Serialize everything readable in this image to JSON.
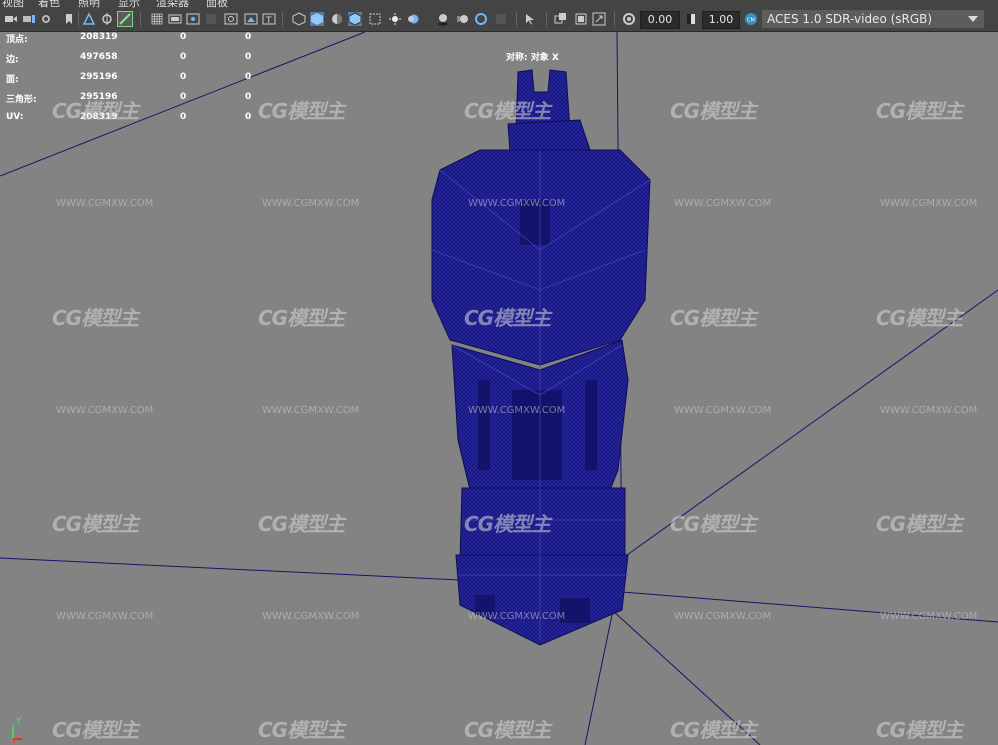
{
  "menu": [
    "视图",
    "着色",
    "照明",
    "显示",
    "渲染器",
    "面板"
  ],
  "toolbar": {
    "exposure_value": "0.00",
    "gamma_value": "1.00",
    "colorspace": "ACES 1.0 SDR-video (sRGB)"
  },
  "hud": {
    "rows": [
      {
        "label": "顶点:",
        "total": "208319",
        "sel": "0",
        "comp": "0"
      },
      {
        "label": "边:",
        "total": "497658",
        "sel": "0",
        "comp": "0"
      },
      {
        "label": "面:",
        "total": "295196",
        "sel": "0",
        "comp": "0"
      },
      {
        "label": "三角形:",
        "total": "295196",
        "sel": "0",
        "comp": "0"
      },
      {
        "label": "UV:",
        "total": "208319",
        "sel": "0",
        "comp": "0"
      }
    ]
  },
  "object_label": "对称: 对象 X",
  "watermark": {
    "logo": "CG模型主",
    "url": "WWW.CGMXW.COM"
  },
  "axis": {
    "y": "Y",
    "x": "X"
  },
  "colors": {
    "viewport_bg": "#838383",
    "wire": "#14146e",
    "toolbar": "#444444",
    "accent": "#3c8dbc"
  }
}
